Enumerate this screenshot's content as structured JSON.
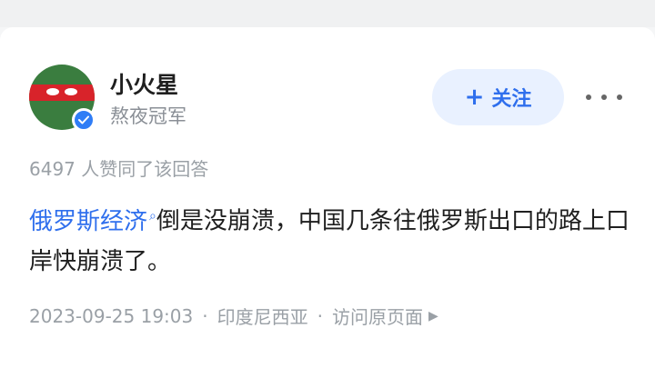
{
  "user": {
    "name": "小火星",
    "title": "熬夜冠军",
    "avatar_icon": "ninja-turtle-avatar"
  },
  "actions": {
    "follow_label": "关注",
    "follow_icon": "plus-icon",
    "more_icon": "more-dots-icon"
  },
  "likes_text": "6497 人赞同了该回答",
  "answer": {
    "topic_link": "俄罗斯经济",
    "text_line": "倒是没崩溃，中国几条往俄罗斯出口的路上口岸快崩溃了。"
  },
  "meta": {
    "datetime": "2023-09-25 19:03",
    "location": "印度尼西亚",
    "visit_original": "访问原页面",
    "separator": "·"
  },
  "colors": {
    "link_blue": "#2f6fed",
    "follow_bg": "#e9f1ff",
    "muted_text": "#9aa0a6",
    "badge_blue": "#2f7df6"
  }
}
